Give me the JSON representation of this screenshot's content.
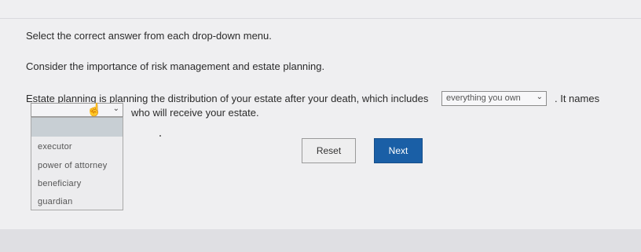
{
  "instruction": "Select the correct answer from each drop-down menu.",
  "prompt": "Consider the importance of risk management and estate planning.",
  "sentence": {
    "part1": "Estate planning is planning the distribution of your estate after your death, which includes",
    "select1_value": "everything you own",
    "part2": ". It names",
    "part3": "who will receive your estate."
  },
  "dropdown2": {
    "selected": "",
    "options": [
      "executor",
      "power of attorney",
      "beneficiary",
      "guardian"
    ]
  },
  "buttons": {
    "reset": "Reset",
    "next": "Next"
  },
  "colors": {
    "next_bg": "#1a5fa6",
    "highlight": "#c8cfd4"
  },
  "icons": {
    "chevron": "chevron-down-icon",
    "cursor": "hand-cursor-icon"
  }
}
